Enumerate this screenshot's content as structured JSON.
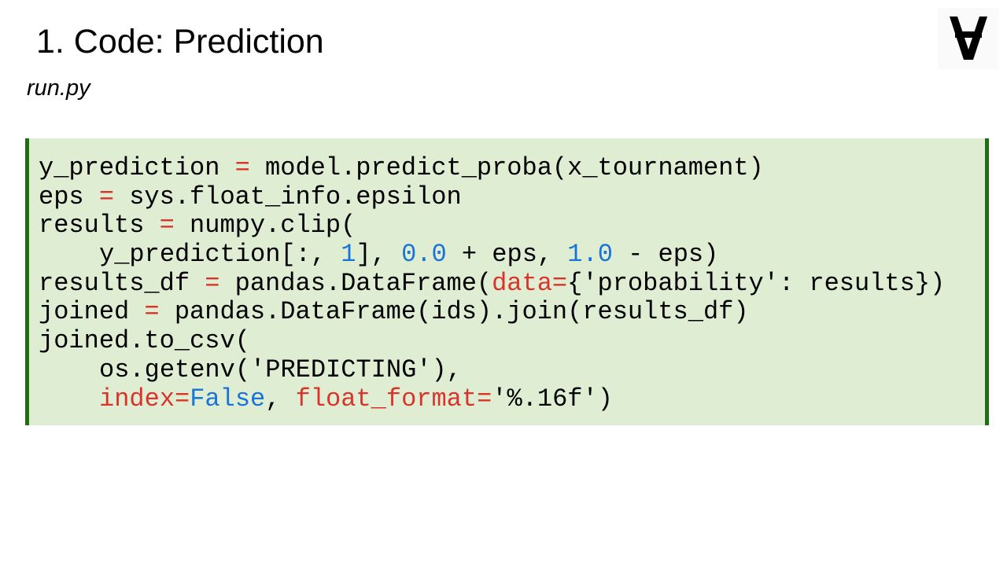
{
  "slide": {
    "title": "1. Code: Prediction",
    "subtitle": "run.py"
  },
  "logo": {
    "icon": "inverted-a-logo-icon",
    "glyph": "∀"
  },
  "colors": {
    "code_background": "#dfeed3",
    "code_border": "#1e6e12",
    "keyword": "#d9342b",
    "number": "#1a73d6"
  },
  "code": {
    "lines": [
      {
        "indent": false,
        "tokens": [
          {
            "t": "y_prediction ",
            "c": "plain"
          },
          {
            "t": "=",
            "c": "op"
          },
          {
            "t": " model.predict_proba(x_tournament)",
            "c": "plain"
          }
        ]
      },
      {
        "indent": false,
        "tokens": [
          {
            "t": "eps ",
            "c": "plain"
          },
          {
            "t": "=",
            "c": "op"
          },
          {
            "t": " sys.float_info.epsilon",
            "c": "plain"
          }
        ]
      },
      {
        "indent": false,
        "tokens": [
          {
            "t": "results ",
            "c": "plain"
          },
          {
            "t": "=",
            "c": "op"
          },
          {
            "t": " numpy.clip(",
            "c": "plain"
          }
        ]
      },
      {
        "indent": true,
        "tokens": [
          {
            "t": "y_prediction[:, ",
            "c": "plain"
          },
          {
            "t": "1",
            "c": "num"
          },
          {
            "t": "], ",
            "c": "plain"
          },
          {
            "t": "0.0",
            "c": "num"
          },
          {
            "t": " + eps, ",
            "c": "plain"
          },
          {
            "t": "1.0",
            "c": "num"
          },
          {
            "t": " - eps)",
            "c": "plain"
          }
        ]
      },
      {
        "indent": false,
        "tokens": [
          {
            "t": "results_df ",
            "c": "plain"
          },
          {
            "t": "=",
            "c": "op"
          },
          {
            "t": " pandas.DataFrame(",
            "c": "plain"
          },
          {
            "t": "data=",
            "c": "kw"
          },
          {
            "t": "{'probability': results})",
            "c": "plain"
          }
        ]
      },
      {
        "indent": false,
        "tokens": [
          {
            "t": "joined ",
            "c": "plain"
          },
          {
            "t": "=",
            "c": "op"
          },
          {
            "t": " pandas.DataFrame(ids).join(results_df)",
            "c": "plain"
          }
        ]
      },
      {
        "indent": false,
        "tokens": [
          {
            "t": "joined.to_csv(",
            "c": "plain"
          }
        ]
      },
      {
        "indent": true,
        "tokens": [
          {
            "t": "os.getenv('PREDICTING'),",
            "c": "plain"
          }
        ]
      },
      {
        "indent": true,
        "tokens": [
          {
            "t": "index=",
            "c": "kw"
          },
          {
            "t": "False",
            "c": "num"
          },
          {
            "t": ", ",
            "c": "plain"
          },
          {
            "t": "float_format=",
            "c": "kw"
          },
          {
            "t": "'%.16f')",
            "c": "plain"
          }
        ]
      }
    ]
  }
}
